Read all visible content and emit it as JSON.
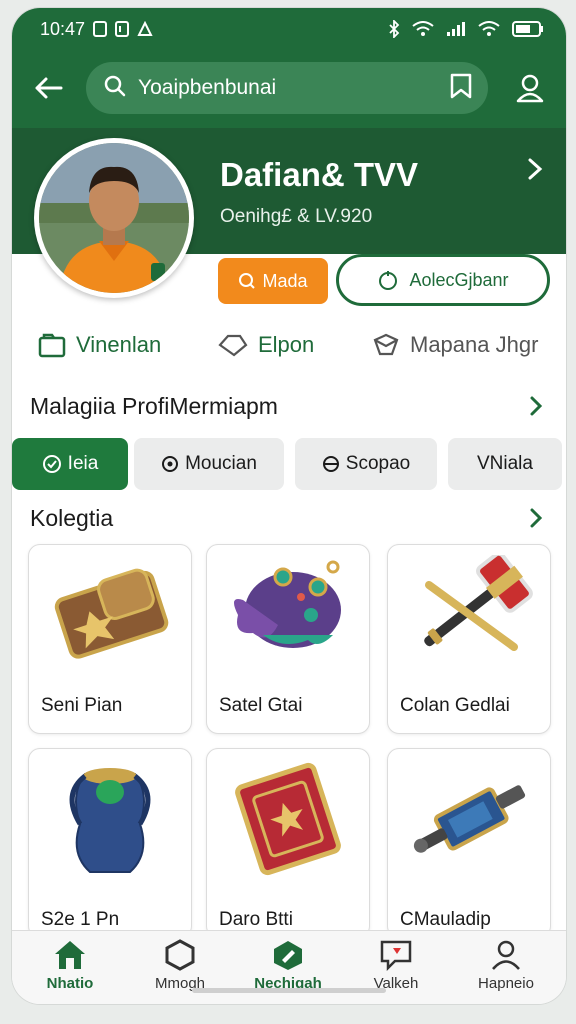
{
  "status_bar": {
    "time": "10:47",
    "icons": [
      "notification-icon",
      "notification-icon",
      "app-icon",
      "bluetooth-icon",
      "wifi-icon",
      "signal-icon",
      "wifi-icon",
      "battery-icon"
    ]
  },
  "top_bar": {
    "search_value": "Yoaipbenbunai",
    "search_icon": "search-icon",
    "bookmark_icon": "bookmark-icon",
    "profile_icon": "user-icon"
  },
  "header": {
    "title": "Dafian& TVV",
    "subtitle": "Oenihg£ & LV.920"
  },
  "buttons": {
    "follow_label": "Mada",
    "action_label": "AolecGjbanr"
  },
  "stats": [
    {
      "label": "Vinenlan",
      "icon": "folder-icon"
    },
    {
      "label": "Elpon",
      "icon": "tag-icon"
    },
    {
      "label": "Mapana Jhgr",
      "icon": "cube-icon"
    }
  ],
  "sections": {
    "profile_title": "Malagiia ProfiMermiapm",
    "collection_title": "Kolegtia"
  },
  "tabs": [
    {
      "label": "Ieia",
      "active": true
    },
    {
      "label": "Moucian",
      "active": false
    },
    {
      "label": "Scopao",
      "active": false
    },
    {
      "label": "VNiala",
      "active": false
    }
  ],
  "items": [
    {
      "label": "Seni Pian",
      "icon": "wallet-icon"
    },
    {
      "label": "Satel Gtai",
      "icon": "creature-icon"
    },
    {
      "label": "Colan Gedlai",
      "icon": "hammer-icon"
    },
    {
      "label": "S2e 1 Pn",
      "icon": "vase-icon"
    },
    {
      "label": "Daro Btti",
      "icon": "book-icon"
    },
    {
      "label": "CMauladip",
      "icon": "device-icon"
    }
  ],
  "bottom_nav": [
    {
      "label": "Nhatio",
      "icon": "home-icon",
      "active": true
    },
    {
      "label": "Mmogh",
      "icon": "hexagon-icon",
      "active": false
    },
    {
      "label": "Nechigah",
      "icon": "edit-icon",
      "active": false
    },
    {
      "label": "Valkeh",
      "icon": "chat-icon",
      "active": false
    },
    {
      "label": "Hapneio",
      "icon": "profile-icon",
      "active": false
    }
  ],
  "colors": {
    "brand_green": "#1f6b3a",
    "dark_green": "#1e5a33",
    "accent_orange": "#f28a1c"
  }
}
